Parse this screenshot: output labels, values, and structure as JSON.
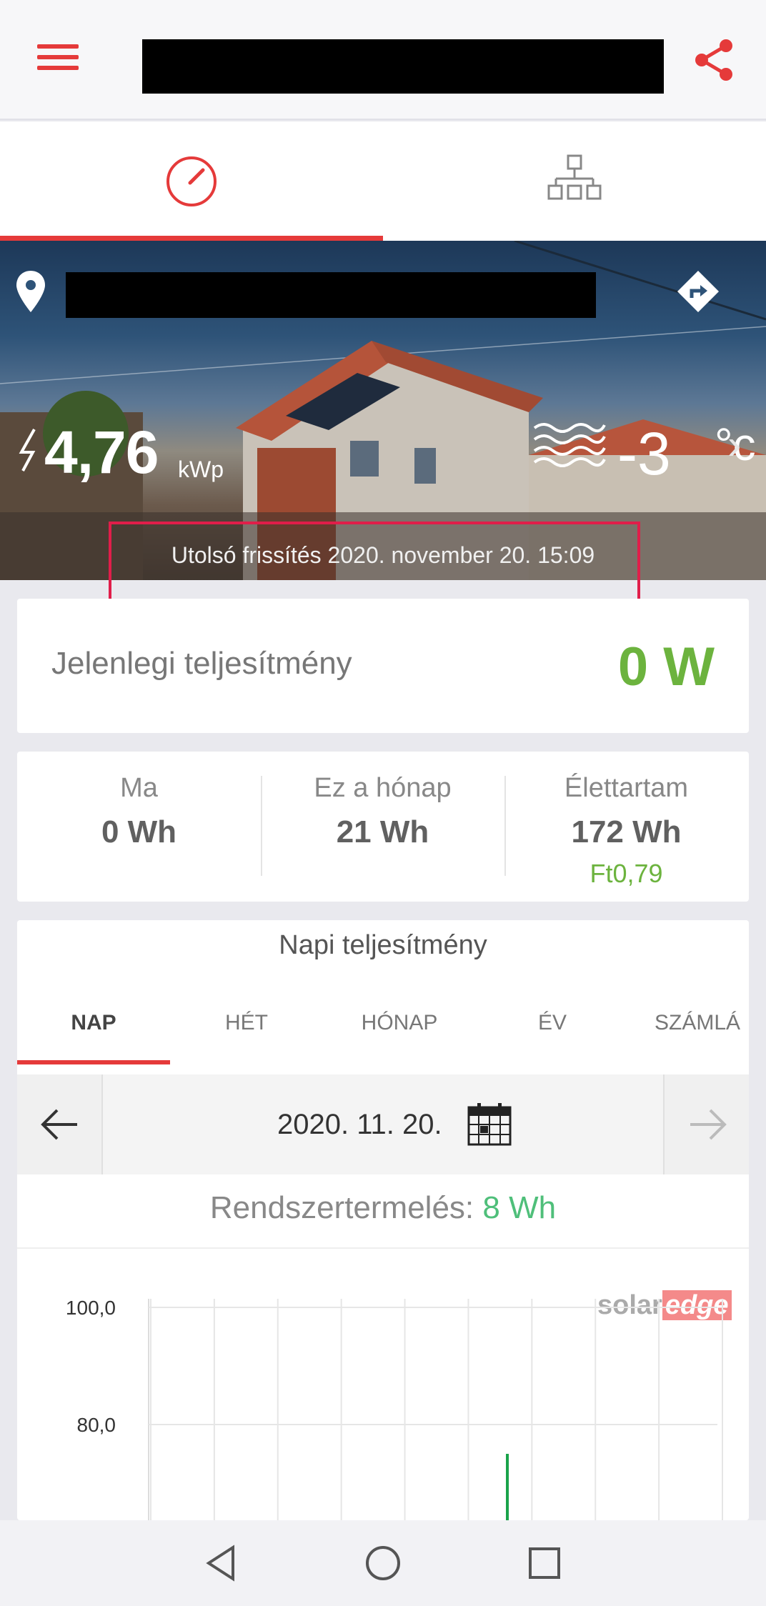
{
  "header": {
    "menu_icon": "menu-icon",
    "share_icon": "share-icon"
  },
  "tabs": [
    {
      "name": "dashboard",
      "icon": "gauge-icon",
      "active": true
    },
    {
      "name": "layout",
      "icon": "site-layout-icon",
      "active": false
    }
  ],
  "site": {
    "peak_power": "4,76",
    "peak_unit": "kWp",
    "temperature": "-3",
    "temperature_unit": "°c",
    "last_update": "Utolsó frissítés 2020. november 20. 15:09"
  },
  "current_power": {
    "label": "Jelenlegi teljesítmény",
    "value": "0 W"
  },
  "energy": [
    {
      "label": "Ma",
      "value": "0  Wh"
    },
    {
      "label": "Ez a hónap",
      "value": "21  Wh"
    },
    {
      "label": "Élettartam",
      "value": "172  Wh",
      "money": "Ft0,79"
    }
  ],
  "daily": {
    "title": "Napi teljesítmény",
    "period_tabs": [
      "NAP",
      "HÉT",
      "HÓNAP",
      "ÉV",
      "SZÁMLÁ"
    ],
    "active_period": "NAP",
    "date": "2020. 11. 20.",
    "system_production_label": "Rendszertermelés:",
    "system_production_value": "8 Wh",
    "brand": {
      "part1": "solar",
      "part2": "edge"
    }
  },
  "colors": {
    "accent": "#e53a3a",
    "green": "#6cb33e",
    "chart_bar": "#1aa34a",
    "highlight": "#e01e4a"
  },
  "chart_data": {
    "type": "bar",
    "y_ticks": [
      "100,0",
      "80,0"
    ],
    "ylim": [
      0,
      100
    ],
    "x_gridlines": 10,
    "series": [
      {
        "values": [
          75
        ]
      }
    ],
    "grid": true
  }
}
